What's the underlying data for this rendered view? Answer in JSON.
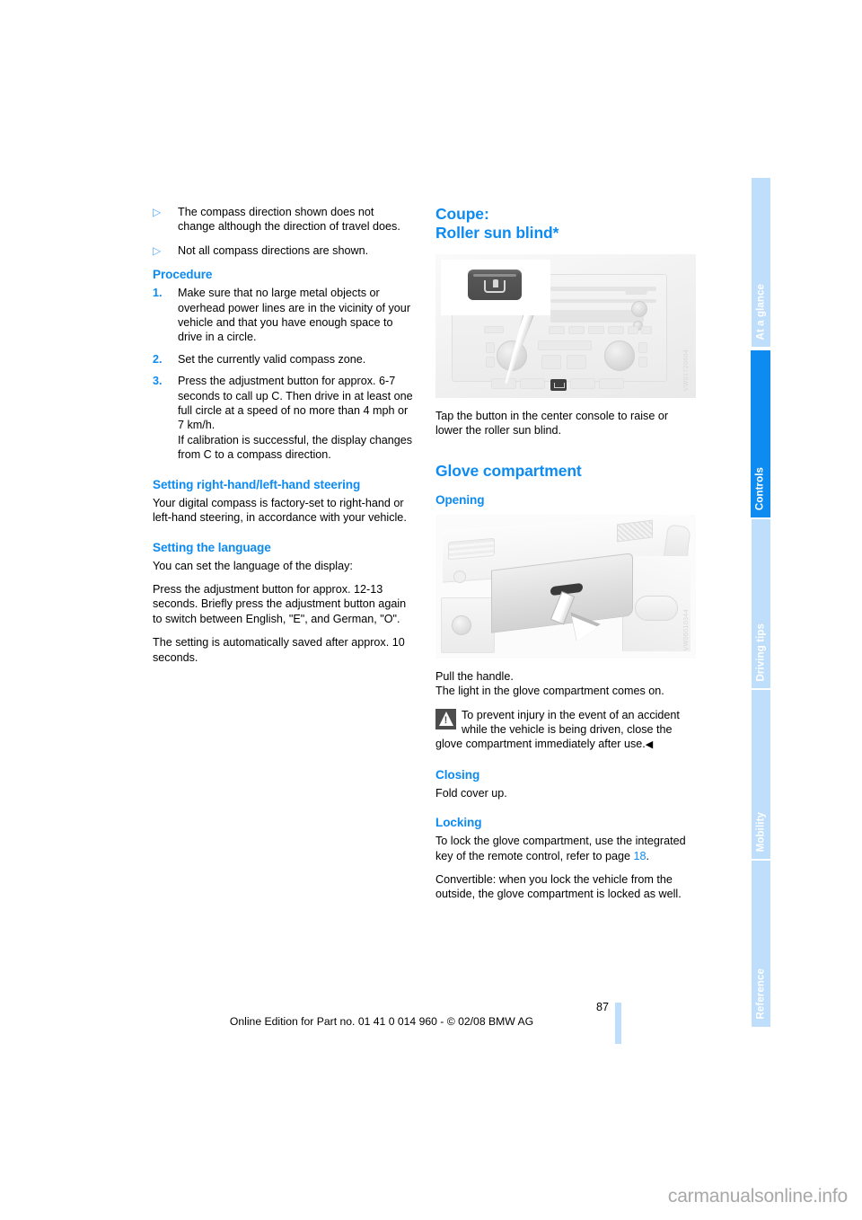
{
  "document": {
    "page_number": "87",
    "edition_line": "Online Edition for Part no. 01 41 0 014 960 - © 02/08 BMW AG",
    "watermark": "carmanualsonline.info"
  },
  "colors": {
    "heading_blue": "#0d8bf0",
    "tab_inactive": "#bfdefb",
    "tab_active": "#0d8bf0",
    "bullet_blue": "#53a9f5"
  },
  "sidebar": {
    "tabs": [
      {
        "label": "At a glance",
        "active": false
      },
      {
        "label": "Controls",
        "active": true
      },
      {
        "label": "Driving tips",
        "active": false
      },
      {
        "label": "Mobility",
        "active": false
      },
      {
        "label": "Reference",
        "active": false
      }
    ]
  },
  "left_column": {
    "bullets": [
      {
        "marker": "▷",
        "text": "The compass direction shown does not change although the direction of travel does."
      },
      {
        "marker": "▷",
        "text": "Not all compass directions are shown."
      }
    ],
    "procedure": {
      "heading": "Procedure",
      "steps": [
        {
          "num": "1.",
          "text": "Make sure that no large metal objects or overhead power lines are in the vicinity of your vehicle and that you have enough space to drive in a circle."
        },
        {
          "num": "2.",
          "text": "Set the currently valid compass zone."
        },
        {
          "num": "3.",
          "text": "Press the adjustment button for approx. 6-7 seconds to call up C. Then drive in at least one full circle at a speed of no more than 4 mph or 7 km/h.\nIf calibration is successful, the display changes from C to a compass direction."
        }
      ]
    },
    "steering": {
      "heading": "Setting right-hand/left-hand steering",
      "body": "Your digital compass is factory-set to right-hand or left-hand steering, in accordance with your vehicle."
    },
    "language": {
      "heading": "Setting the language",
      "intro": "You can set the language of the display:",
      "body": "Press the adjustment button for approx. 12-13 seconds. Briefly press the adjustment button again to switch between English, \"E\", and German, \"O\".",
      "note": "The setting is automatically saved after approx. 10 seconds."
    }
  },
  "right_column": {
    "roller_blind": {
      "heading_line1": "Coupe:",
      "heading_line2": "Roller sun blind*",
      "figure": {
        "name": "center-console-roller-blind-button",
        "code": "VW01720604"
      },
      "caption": "Tap the button in the center console to raise or lower the roller sun blind."
    },
    "glove": {
      "heading": "Glove compartment",
      "opening": {
        "heading": "Opening",
        "figure": {
          "name": "glove-compartment-opening",
          "code": "VW06010344"
        },
        "line1": "Pull the handle.",
        "line2": "The light in the glove compartment comes on."
      },
      "warning": {
        "icon": "warning-triangle-icon",
        "text": "To prevent injury in the event of an accident while the vehicle is being driven, close the glove compartment immediately after use.",
        "end_mark": "◀"
      },
      "closing": {
        "heading": "Closing",
        "body": "Fold cover up."
      },
      "locking": {
        "heading": "Locking",
        "body_pre": "To lock the glove compartment, use the integrated key of the remote control, refer to page ",
        "page_ref": "18",
        "body_post": ".",
        "convertible": "Convertible: when you lock the vehicle from the outside, the glove compartment is locked as well."
      }
    }
  }
}
